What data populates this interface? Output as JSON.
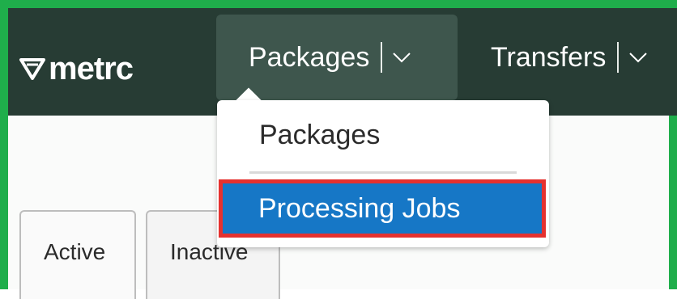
{
  "brand": {
    "logo_text": "metrc",
    "logo_icon": "metrc-shield-icon"
  },
  "navbar": {
    "items": [
      {
        "label": "Packages",
        "icon": "chevron-down-icon",
        "expanded": true
      },
      {
        "label": "Transfers",
        "icon": "chevron-down-icon",
        "expanded": false
      }
    ]
  },
  "dropdown": {
    "items": [
      {
        "label": "Packages",
        "highlighted": false
      },
      {
        "label": "Processing Jobs",
        "highlighted": true
      }
    ]
  },
  "tabs": [
    {
      "label": "Active"
    },
    {
      "label": "Inactive"
    }
  ],
  "colors": {
    "frame": "#1fae4b",
    "navbar": "#273c34",
    "nav_active": "#3e564d",
    "menu_highlight": "#1677c6",
    "highlight_border": "#e5312f"
  }
}
